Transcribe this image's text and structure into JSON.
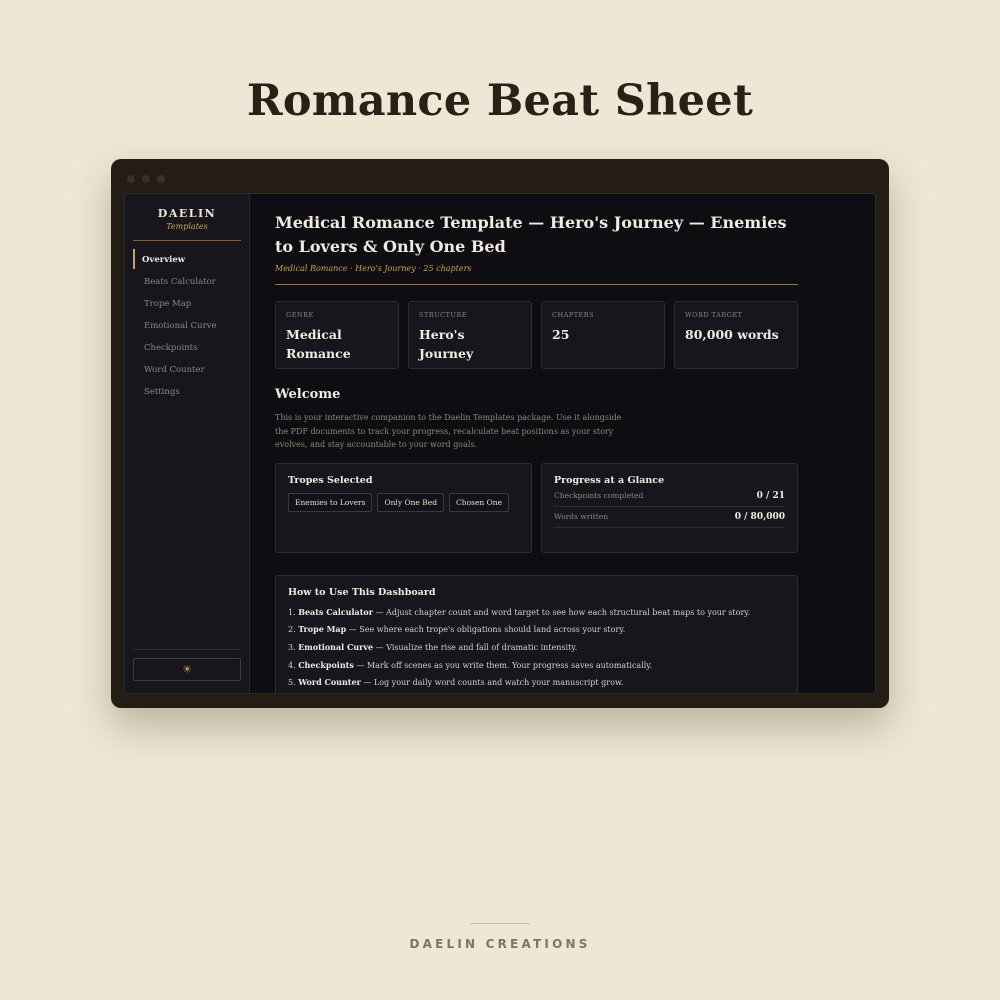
{
  "page_title": "Romance Beat Sheet",
  "footer": "DAELIN CREATIONS",
  "sidebar": {
    "brand": "DAELIN",
    "brand_sub": "Templates",
    "items": [
      {
        "label": "Overview"
      },
      {
        "label": "Beats Calculator"
      },
      {
        "label": "Trope Map"
      },
      {
        "label": "Emotional Curve"
      },
      {
        "label": "Checkpoints"
      },
      {
        "label": "Word Counter"
      },
      {
        "label": "Settings"
      }
    ],
    "active_item": "Overview",
    "theme_toggle_icon": "sun-icon",
    "theme_toggle_glyph": "☀"
  },
  "main": {
    "title": "Medical Romance Template — Hero's Journey — Enemies to Lovers & Only One Bed",
    "subtitle": "Medical Romance · Hero's Journey · 25 chapters",
    "stats": [
      {
        "label": "GENRE",
        "value": "Medical Romance"
      },
      {
        "label": "STRUCTURE",
        "value": "Hero's Journey"
      },
      {
        "label": "CHAPTERS",
        "value": "25"
      },
      {
        "label": "WORD TARGET",
        "value": "80,000 words"
      }
    ],
    "welcome": {
      "heading": "Welcome",
      "body": "This is your interactive companion to the Daelin Templates package. Use it alongside the PDF documents to track your progress, recalculate beat positions as your story evolves, and stay accountable to your word goals."
    },
    "tropes": {
      "heading": "Tropes Selected",
      "chips": [
        "Enemies to Lovers",
        "Only One Bed",
        "Chosen One"
      ]
    },
    "progress": {
      "heading": "Progress at a Glance",
      "rows": [
        {
          "label": "Checkpoints completed",
          "value": "0 / 21"
        },
        {
          "label": "Words written",
          "value": "0 / 80,000"
        }
      ]
    },
    "howto": {
      "heading": "How to Use This Dashboard",
      "items": [
        {
          "num": "1.",
          "term": "Beats Calculator",
          "desc": " — Adjust chapter count and word target to see how each structural beat maps to your story."
        },
        {
          "num": "2.",
          "term": "Trope Map",
          "desc": " — See where each trope's obligations should land across your story."
        },
        {
          "num": "3.",
          "term": "Emotional Curve",
          "desc": " — Visualize the rise and fall of dramatic intensity."
        },
        {
          "num": "4.",
          "term": "Checkpoints",
          "desc": " — Mark off scenes as you write them. Your progress saves automatically."
        },
        {
          "num": "5.",
          "term": "Word Counter",
          "desc": " — Log your daily word counts and watch your manuscript grow."
        }
      ]
    }
  },
  "colors": {
    "accent": "#c9a453",
    "background": "#efe6d5",
    "screen": "#0e0d11",
    "panel": "#17161d"
  }
}
